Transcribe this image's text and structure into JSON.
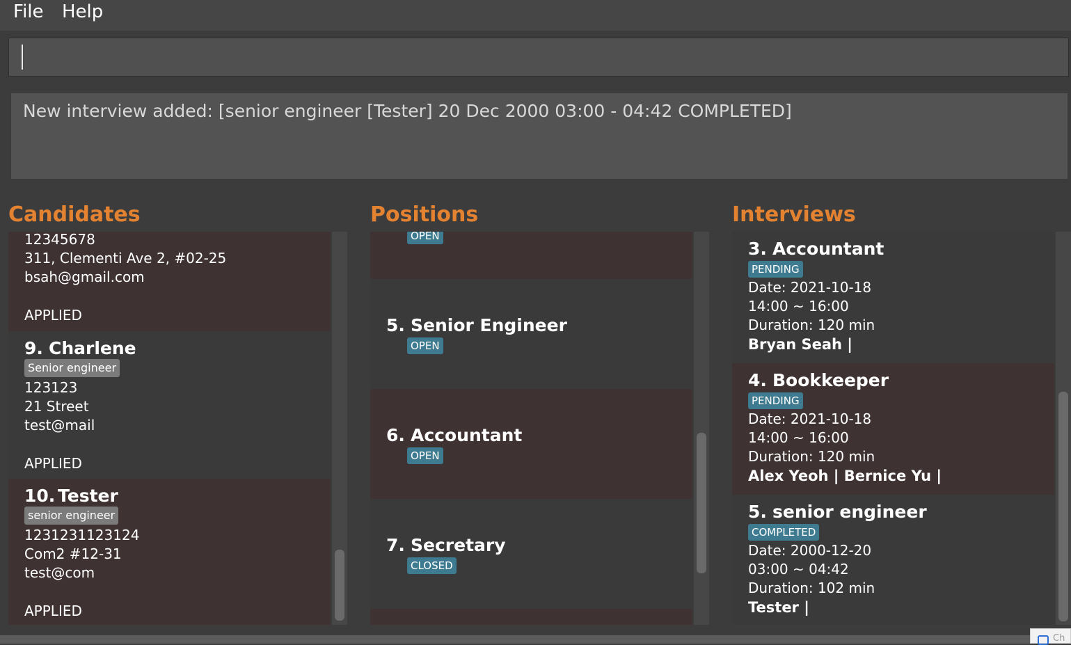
{
  "menu": {
    "file": "File",
    "help": "Help"
  },
  "command_box": {
    "value": ""
  },
  "result": {
    "text": "New interview added: [senior engineer [Tester] 20 Dec 2000 03:00 - 04:42 COMPLETED]"
  },
  "panels": {
    "candidates_title": "Candidates",
    "positions_title": "Positions",
    "interviews_title": "Interviews"
  },
  "candidates": [
    {
      "phone": "12345678",
      "address": "311, Clementi Ave 2, #02-25",
      "email": "bsah@gmail.com",
      "status": "APPLIED"
    },
    {
      "index": "9.",
      "name": "Charlene",
      "tag": "Senior engineer",
      "phone": "123123",
      "address": "21 Street",
      "email": "test@mail",
      "status": "APPLIED"
    },
    {
      "index": "10.",
      "name": "Tester",
      "tag": "senior engineer",
      "phone": "1231231123124",
      "address": "Com2 #12-31",
      "email": "test@com",
      "status": "APPLIED"
    }
  ],
  "positions": [
    {
      "status": "OPEN"
    },
    {
      "index": "5.",
      "title": "Senior Engineer",
      "status": "OPEN"
    },
    {
      "index": "6.",
      "title": "Accountant",
      "status": "OPEN"
    },
    {
      "index": "7.",
      "title": "Secretary",
      "status": "CLOSED"
    }
  ],
  "interviews": [
    {
      "index": "3.",
      "title": "Accountant",
      "status": "PENDING",
      "date": "Date: 2021-10-18",
      "time": "14:00 ~ 16:00",
      "duration": "Duration: 120 min",
      "candidates": "Bryan Seah |"
    },
    {
      "index": "4.",
      "title": "Bookkeeper",
      "status": "PENDING",
      "date": "Date: 2021-10-18",
      "time": "14:00 ~ 16:00",
      "duration": "Duration: 120 min",
      "candidates": "Alex Yeoh | Bernice Yu |"
    },
    {
      "index": "5.",
      "title": "senior engineer",
      "status": "COMPLETED",
      "date": "Date: 2000-12-20",
      "time": "03:00 ~ 04:42",
      "duration": "Duration: 102 min",
      "candidates": "Tester |"
    }
  ],
  "taskbar": {
    "partial_text": "Ch"
  }
}
